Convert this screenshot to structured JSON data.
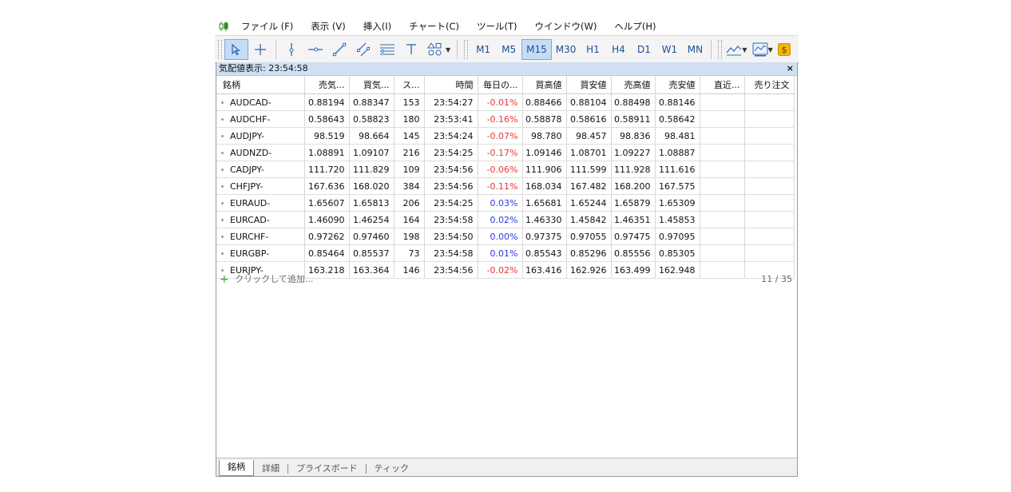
{
  "menu": [
    "ファイル (F)",
    "表示 (V)",
    "挿入(I)",
    "チャート(C)",
    "ツール(T)",
    "ウインドウ(W)",
    "ヘルプ(H)"
  ],
  "toolbar": {
    "icons": [
      "cursor-icon",
      "crosshair-icon",
      "vertical-line-icon",
      "horizontal-line-icon",
      "trendline-icon",
      "channel-icon",
      "fibonacci-icon",
      "text-icon",
      "shapes-icon"
    ],
    "timeframes": [
      "M1",
      "M5",
      "M15",
      "M30",
      "H1",
      "H4",
      "D1",
      "W1",
      "MN"
    ],
    "selected_timeframe": "M15"
  },
  "panel": {
    "title": "気配値表示: 23:54:58",
    "close": "×",
    "columns": [
      "銘柄",
      "売気...",
      "買気...",
      "ス...",
      "時間",
      "毎日の...",
      "買高値",
      "買安値",
      "売高値",
      "売安値",
      "直近...",
      "売り注文"
    ],
    "rows": [
      {
        "symbol": "AUDCAD-",
        "bid": "0.88194",
        "ask": "0.88347",
        "spread": "153",
        "time": "23:54:27",
        "change": "-0.01%",
        "dir": "neg",
        "bid_high": "0.88466",
        "bid_low": "0.88104",
        "ask_high": "0.88498",
        "ask_low": "0.88146"
      },
      {
        "symbol": "AUDCHF-",
        "bid": "0.58643",
        "ask": "0.58823",
        "spread": "180",
        "time": "23:53:41",
        "change": "-0.16%",
        "dir": "neg",
        "bid_high": "0.58878",
        "bid_low": "0.58616",
        "ask_high": "0.58911",
        "ask_low": "0.58642"
      },
      {
        "symbol": "AUDJPY-",
        "bid": "98.519",
        "ask": "98.664",
        "spread": "145",
        "time": "23:54:24",
        "change": "-0.07%",
        "dir": "neg",
        "bid_high": "98.780",
        "bid_low": "98.457",
        "ask_high": "98.836",
        "ask_low": "98.481"
      },
      {
        "symbol": "AUDNZD-",
        "bid": "1.08891",
        "ask": "1.09107",
        "spread": "216",
        "time": "23:54:25",
        "change": "-0.17%",
        "dir": "neg",
        "bid_high": "1.09146",
        "bid_low": "1.08701",
        "ask_high": "1.09227",
        "ask_low": "1.08887"
      },
      {
        "symbol": "CADJPY-",
        "bid": "111.720",
        "ask": "111.829",
        "spread": "109",
        "time": "23:54:56",
        "change": "-0.06%",
        "dir": "neg",
        "bid_high": "111.906",
        "bid_low": "111.599",
        "ask_high": "111.928",
        "ask_low": "111.616"
      },
      {
        "symbol": "CHFJPY-",
        "bid": "167.636",
        "ask": "168.020",
        "spread": "384",
        "time": "23:54:56",
        "change": "-0.11%",
        "dir": "neg",
        "bid_high": "168.034",
        "bid_low": "167.482",
        "ask_high": "168.200",
        "ask_low": "167.575"
      },
      {
        "symbol": "EURAUD-",
        "bid": "1.65607",
        "ask": "1.65813",
        "spread": "206",
        "time": "23:54:25",
        "change": "0.03%",
        "dir": "pos",
        "bid_high": "1.65681",
        "bid_low": "1.65244",
        "ask_high": "1.65879",
        "ask_low": "1.65309"
      },
      {
        "symbol": "EURCAD-",
        "bid": "1.46090",
        "ask": "1.46254",
        "spread": "164",
        "time": "23:54:58",
        "change": "0.02%",
        "dir": "pos",
        "bid_high": "1.46330",
        "bid_low": "1.45842",
        "ask_high": "1.46351",
        "ask_low": "1.45853"
      },
      {
        "symbol": "EURCHF-",
        "bid": "0.97262",
        "ask": "0.97460",
        "spread": "198",
        "time": "23:54:50",
        "change": "0.00%",
        "dir": "pos",
        "bid_high": "0.97375",
        "bid_low": "0.97055",
        "ask_high": "0.97475",
        "ask_low": "0.97095"
      },
      {
        "symbol": "EURGBP-",
        "bid": "0.85464",
        "ask": "0.85537",
        "spread": "73",
        "time": "23:54:58",
        "change": "0.01%",
        "dir": "pos",
        "bid_high": "0.85543",
        "bid_low": "0.85296",
        "ask_high": "0.85556",
        "ask_low": "0.85305"
      },
      {
        "symbol": "EURJPY-",
        "bid": "163.218",
        "ask": "163.364",
        "spread": "146",
        "time": "23:54:56",
        "change": "-0.02%",
        "dir": "neg",
        "bid_high": "163.416",
        "bid_low": "162.926",
        "ask_high": "163.499",
        "ask_low": "162.948"
      }
    ],
    "add_label": "クリックして追加...",
    "count": "11 / 35"
  },
  "tabs": [
    "銘柄",
    "詳細",
    "プライスボード",
    "ティック"
  ],
  "active_tab": "銘柄",
  "colors": {
    "negative": "#e8363c",
    "positive": "#2b3bd9",
    "selection": "#c5dcf5",
    "title_bar": "#cfe0f3"
  }
}
